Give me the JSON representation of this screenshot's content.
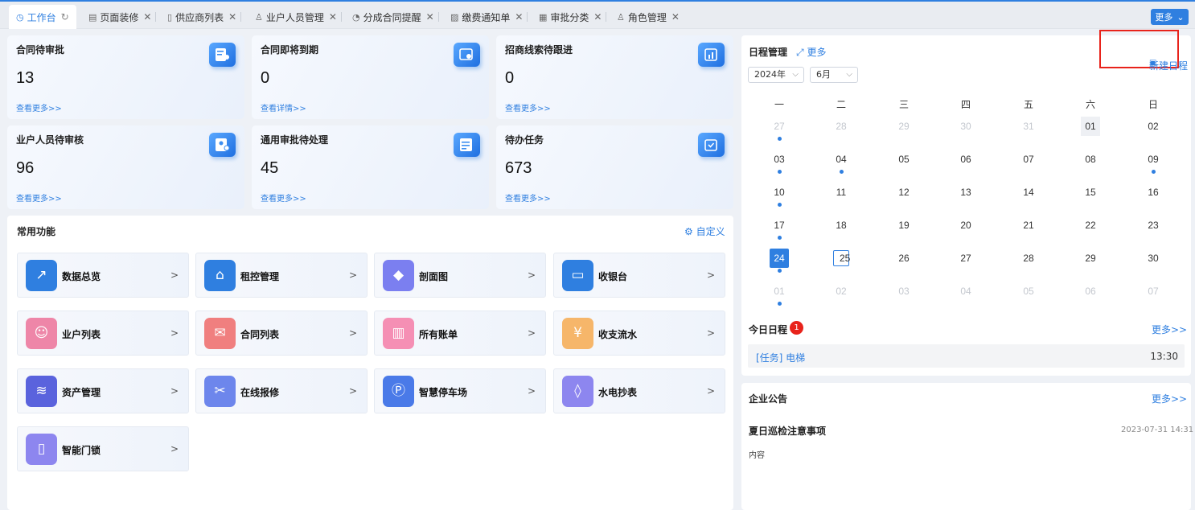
{
  "tabs": [
    {
      "label": "工作台",
      "icon": "dashboard-icon",
      "active": true
    },
    {
      "label": "页面装修",
      "icon": "layout-icon"
    },
    {
      "label": "供应商列表",
      "icon": "file-icon"
    },
    {
      "label": "业户人员管理",
      "icon": "user-icon"
    },
    {
      "label": "分成合同提醒",
      "icon": "clock-icon"
    },
    {
      "label": "缴费通知单",
      "icon": "document-icon"
    },
    {
      "label": "审批分类",
      "icon": "grid-icon"
    },
    {
      "label": "角色管理",
      "icon": "role-icon"
    }
  ],
  "tabbar_more": "更多",
  "stats": [
    {
      "title": "合同待审批",
      "value": "13",
      "link": "查看更多>>",
      "icon": "contract-approve-icon"
    },
    {
      "title": "合同即将到期",
      "value": "0",
      "link": "查看详情>>",
      "icon": "contract-expire-icon"
    },
    {
      "title": "招商线索待跟进",
      "value": "0",
      "link": "查看更多>>",
      "icon": "lead-icon"
    },
    {
      "title": "业户人员待审核",
      "value": "96",
      "link": "查看更多>>",
      "icon": "user-review-icon"
    },
    {
      "title": "通用审批待处理",
      "value": "45",
      "link": "查看更多>>",
      "icon": "approval-icon"
    },
    {
      "title": "待办任务",
      "value": "673",
      "link": "查看更多>>",
      "icon": "todo-icon"
    }
  ],
  "functions": {
    "title": "常用功能",
    "customize": "自定义",
    "items": [
      {
        "label": "数据总览",
        "icon": "chart-icon",
        "color": "#2f7fe0"
      },
      {
        "label": "租控管理",
        "icon": "rent-icon",
        "color": "#2f7fe0"
      },
      {
        "label": "剖面图",
        "icon": "cube-icon",
        "color": "#7b7ff0"
      },
      {
        "label": "收银台",
        "icon": "cashier-icon",
        "color": "#2f7fe0"
      },
      {
        "label": "业户列表",
        "icon": "users-icon",
        "color": "#ee86a8"
      },
      {
        "label": "合同列表",
        "icon": "envelope-icon",
        "color": "#f07f7f"
      },
      {
        "label": "所有账单",
        "icon": "bill-icon",
        "color": "#f58fb4"
      },
      {
        "label": "收支流水",
        "icon": "money-bag-icon",
        "color": "#f6b66a"
      },
      {
        "label": "资产管理",
        "icon": "database-icon",
        "color": "#5a63dd"
      },
      {
        "label": "在线报修",
        "icon": "tools-icon",
        "color": "#6d86ec"
      },
      {
        "label": "智慧停车场",
        "icon": "parking-icon",
        "color": "#4a7ae8"
      },
      {
        "label": "水电抄表",
        "icon": "water-drop-icon",
        "color": "#8d86ef"
      },
      {
        "label": "智能门锁",
        "icon": "door-lock-icon",
        "color": "#8d86ef"
      }
    ],
    "arrow": ">"
  },
  "schedule": {
    "title": "日程管理",
    "more": "更多",
    "new": "新建日程",
    "year": "2024年",
    "month": "6月",
    "weekdays": [
      "一",
      "二",
      "三",
      "四",
      "五",
      "六",
      "日"
    ],
    "days": [
      {
        "d": "27",
        "muted": true,
        "dot": true
      },
      {
        "d": "28",
        "muted": true
      },
      {
        "d": "29",
        "muted": true
      },
      {
        "d": "30",
        "muted": true
      },
      {
        "d": "31",
        "muted": true
      },
      {
        "d": "01",
        "hl": true
      },
      {
        "d": "02"
      },
      {
        "d": "03",
        "dot": true
      },
      {
        "d": "04",
        "dot": true
      },
      {
        "d": "05"
      },
      {
        "d": "06"
      },
      {
        "d": "07"
      },
      {
        "d": "08"
      },
      {
        "d": "09",
        "dot": true
      },
      {
        "d": "10",
        "dot": true
      },
      {
        "d": "11"
      },
      {
        "d": "12"
      },
      {
        "d": "13"
      },
      {
        "d": "14"
      },
      {
        "d": "15"
      },
      {
        "d": "16"
      },
      {
        "d": "17",
        "dot": true
      },
      {
        "d": "18"
      },
      {
        "d": "19"
      },
      {
        "d": "20"
      },
      {
        "d": "21"
      },
      {
        "d": "22"
      },
      {
        "d": "23"
      },
      {
        "d": "24",
        "today": true,
        "dot": true
      },
      {
        "d": "25",
        "selected": true
      },
      {
        "d": "26"
      },
      {
        "d": "27"
      },
      {
        "d": "28"
      },
      {
        "d": "29"
      },
      {
        "d": "30"
      },
      {
        "d": "01",
        "muted": true,
        "dot": true
      },
      {
        "d": "02",
        "muted": true
      },
      {
        "d": "03",
        "muted": true
      },
      {
        "d": "04",
        "muted": true
      },
      {
        "d": "05",
        "muted": true
      },
      {
        "d": "06",
        "muted": true
      },
      {
        "d": "07",
        "muted": true
      }
    ],
    "today_label": "今日日程",
    "today_count": "1",
    "today_more": "更多>>",
    "task": {
      "text": "[任务]  电梯",
      "time": "13:30"
    }
  },
  "notice": {
    "title": "企业公告",
    "more": "更多>>",
    "item_title": "夏日巡检注意事项",
    "item_date": "2023-07-31 14:31",
    "item_content": "内容"
  }
}
